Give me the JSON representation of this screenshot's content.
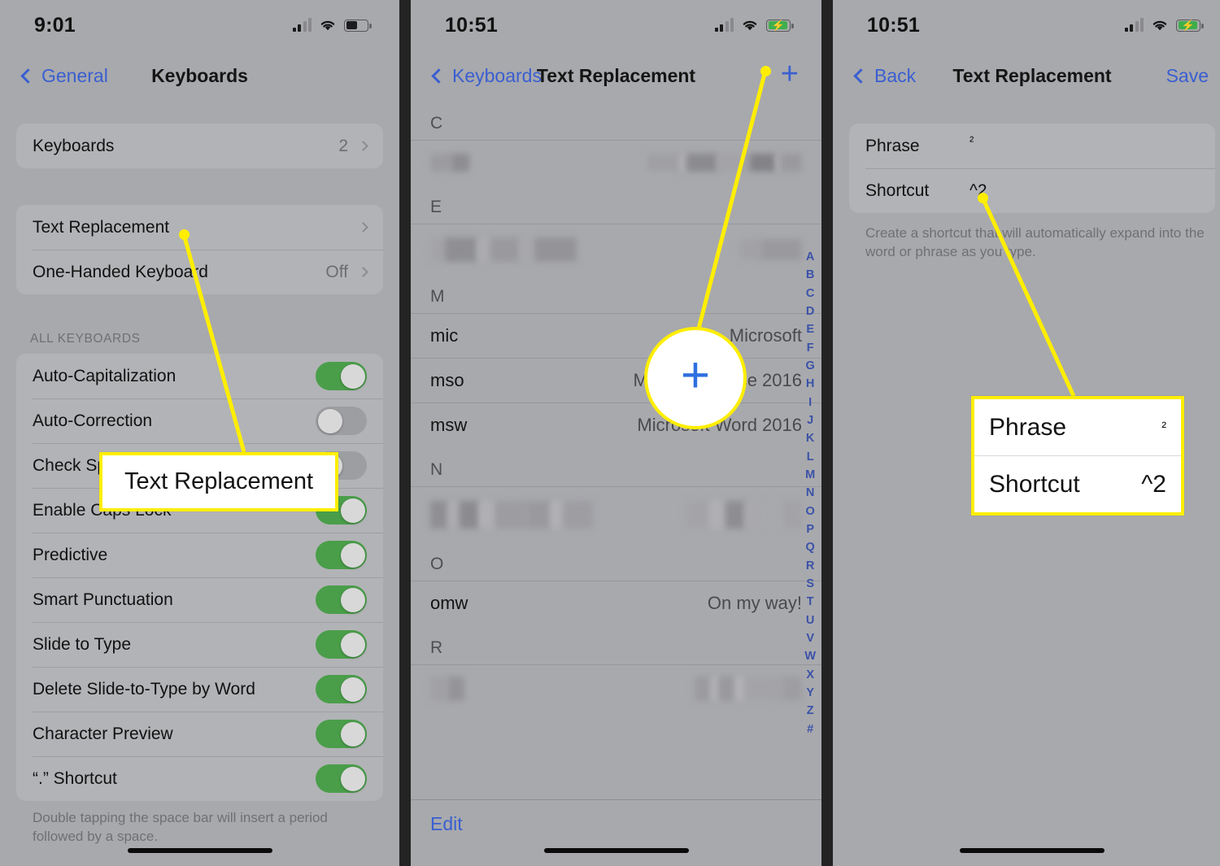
{
  "panels": [
    {
      "id": "keyboards-settings",
      "status": {
        "time": "9:01",
        "battery": "partial",
        "signal": "2-of-4",
        "wifi": "wifi-icon"
      },
      "nav": {
        "back_label": "General",
        "title": "Keyboards"
      },
      "group1": [
        {
          "label": "Keyboards",
          "value": "2",
          "accessory": "chevron"
        }
      ],
      "group2": [
        {
          "label": "Text Replacement",
          "value": "",
          "accessory": "chevron"
        },
        {
          "label": "One-Handed Keyboard",
          "value": "Off",
          "accessory": "chevron"
        }
      ],
      "section_header": "ALL KEYBOARDS",
      "toggles": [
        {
          "label": "Auto-Capitalization",
          "state": "on"
        },
        {
          "label": "Auto-Correction",
          "state": "off"
        },
        {
          "label": "Check Spelling",
          "state": "off"
        },
        {
          "label": "Enable Caps Lock",
          "state": "on"
        },
        {
          "label": "Predictive",
          "state": "on"
        },
        {
          "label": "Smart Punctuation",
          "state": "on"
        },
        {
          "label": "Slide to Type",
          "state": "on"
        },
        {
          "label": "Delete Slide-to-Type by Word",
          "state": "on"
        },
        {
          "label": "Character Preview",
          "state": "on"
        },
        {
          "label": "“.” Shortcut",
          "state": "on"
        }
      ],
      "footnote": "Double tapping the space bar will insert a period followed by a space."
    },
    {
      "id": "text-replacement-list",
      "status": {
        "time": "10:51",
        "battery": "charging",
        "signal": "2-of-4",
        "wifi": "wifi-icon"
      },
      "nav": {
        "back_label": "Keyboards",
        "title": "Text Replacement",
        "add_icon": "plus-icon"
      },
      "sections": [
        {
          "letter": "C",
          "rows": [
            {
              "shortcut": "",
              "phrase": "",
              "redacted": true
            }
          ]
        },
        {
          "letter": "E",
          "rows": [
            {
              "shortcut": "",
              "phrase": "",
              "redacted": true
            }
          ]
        },
        {
          "letter": "M",
          "rows": [
            {
              "shortcut": "mic",
              "phrase": "Microsoft",
              "redacted": false
            },
            {
              "shortcut": "mso",
              "phrase": "Microsoft Office 2016",
              "redacted": false
            },
            {
              "shortcut": "msw",
              "phrase": "Microsoft Word 2016",
              "redacted": false
            }
          ]
        },
        {
          "letter": "N",
          "rows": [
            {
              "shortcut": "",
              "phrase": "",
              "redacted": true
            }
          ]
        },
        {
          "letter": "O",
          "rows": [
            {
              "shortcut": "omw",
              "phrase": "On my way!",
              "redacted": false
            }
          ]
        },
        {
          "letter": "R",
          "rows": [
            {
              "shortcut": "",
              "phrase": "",
              "redacted": true
            }
          ]
        }
      ],
      "edit_label": "Edit",
      "alpha_index": [
        "A",
        "B",
        "C",
        "D",
        "E",
        "F",
        "G",
        "H",
        "I",
        "J",
        "K",
        "L",
        "M",
        "N",
        "O",
        "P",
        "Q",
        "R",
        "S",
        "T",
        "U",
        "V",
        "W",
        "X",
        "Y",
        "Z",
        "#"
      ]
    },
    {
      "id": "text-replacement-editor",
      "status": {
        "time": "10:51",
        "battery": "charging",
        "signal": "2-of-4",
        "wifi": "wifi-icon"
      },
      "nav": {
        "back_label": "Back",
        "title": "Text Replacement",
        "save_label": "Save"
      },
      "fields": [
        {
          "label": "Phrase",
          "value": "²",
          "placeholder": "Phrase"
        },
        {
          "label": "Shortcut",
          "value": "^2",
          "placeholder": "Shortcut"
        }
      ],
      "footnote": "Create a shortcut that will automatically expand into the word or phrase as you type."
    }
  ],
  "annotations": {
    "callout_text_replacement": "Text Replacement",
    "callout_plus_icon": "plus-icon",
    "callout_phrase_label": "Phrase",
    "callout_phrase_value": "²",
    "callout_shortcut_label": "Shortcut",
    "callout_shortcut_value": "^2",
    "highlight_color": "#FFEE00"
  }
}
